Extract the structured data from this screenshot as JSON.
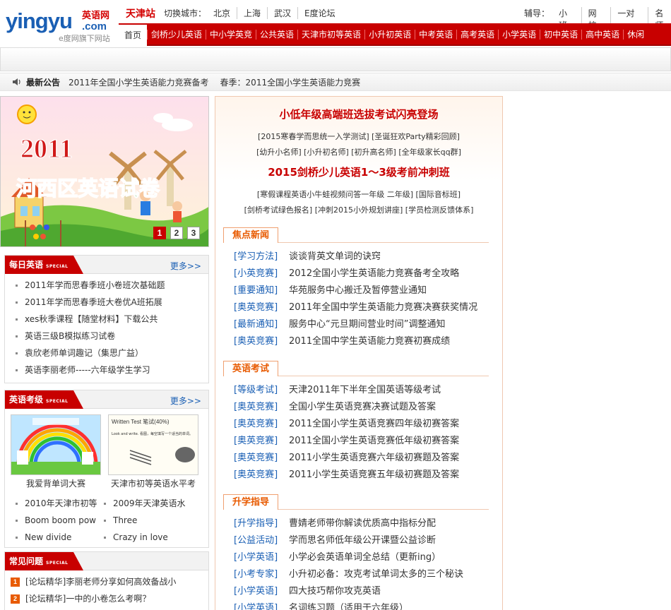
{
  "header": {
    "logo_main": "yingyu",
    "logo_com": ".com",
    "logo_cn": "英语网",
    "logo_sub": "e度网旗下网站",
    "station": "天津站",
    "switch_label": "切换城市：",
    "cities": [
      "北京",
      "上海",
      "武汉",
      "E度论坛"
    ],
    "aux_label": "辅导：",
    "aux_links": [
      "小班",
      "网校",
      "一对一",
      "名师"
    ]
  },
  "nav": {
    "home": "首页",
    "items": [
      "剑桥少儿英语",
      "中小学英竞",
      "公共英语",
      "天津市初等英语",
      "小升初英语",
      "中考英语",
      "高考英语",
      "小学英语",
      "初中英语",
      "高中英语",
      "休闲"
    ]
  },
  "announcement": {
    "label": "最新公告",
    "items": [
      "2011年全国小学生英语能力竞赛备考",
      "春季：2011全国小学生英语能力竞赛"
    ]
  },
  "banner": {
    "year": "2011",
    "title": "河西区英语试卷",
    "pages": [
      "1",
      "2",
      "3"
    ]
  },
  "daily": {
    "title": "每日英语",
    "tag": "SPECIAL",
    "more": "更多>>",
    "items": [
      "2011年学而思春季班小卷班次基础题",
      "2011年学而思春季班大卷优A班拓展",
      "xes秋季课程【随堂材料】下载公共",
      "英语三级B模拟练习试卷",
      "袁欣老师单词趣记（集思广益）",
      "英语李丽老师-----六年级学生学习"
    ]
  },
  "exam": {
    "title": "英语考级",
    "tag": "SPECIAL",
    "more": "更多>>",
    "thumbs": [
      {
        "caption": "我爱背单词大赛"
      },
      {
        "caption": "天津市初等英语水平考",
        "img_title": "Written Test 笔试(40%)",
        "img_text": "Look and write. 看图，每空填写一个适当的单词。"
      }
    ],
    "items": [
      "2010年天津市初等",
      "2009年天津英语水",
      "Boom boom pow",
      "Three",
      "New divide",
      "Crazy in love"
    ]
  },
  "faq": {
    "title": "常见问题",
    "tag": "SPECIAL",
    "items": [
      {
        "num": "1",
        "text": "[论坛精华]李丽老师分享如何高效备战小"
      },
      {
        "num": "2",
        "text": "[论坛精华]一中的小卷怎么考啊？"
      }
    ]
  },
  "feature": {
    "headline1": "小低年级高端班选拔考试闪亮登场",
    "links1a": "[2015寒春学而思统一入学测试] [圣诞狂欢Party精彩回顾]",
    "links1b": "[幼升小名师] [小升初名师] [初升高名师] [全年级家长qq群]",
    "headline2": "2015剑桥少儿英语1～3级考前冲刺班",
    "links2a": "[寒假课程英语小牛蛙视频问答一年级 二年级] [国际音标班]",
    "links2b": "[剑桥考试绿色报名] [冲刺2015小外规划讲座] [学员检测反馈体系]"
  },
  "sections": [
    {
      "title": "焦点新闻",
      "items": [
        {
          "cat": "[学习方法]",
          "text": "谈谈背英文单词的诀窍"
        },
        {
          "cat": "[小英竞赛]",
          "text": "2012全国小学生英语能力竞赛备考全攻略"
        },
        {
          "cat": "[重要通知]",
          "text": "华苑服务中心搬迁及暂停营业通知"
        },
        {
          "cat": "[奥英竞赛]",
          "text": "2011年全国中学生英语能力竞赛决赛获奖情况"
        },
        {
          "cat": "[最新通知]",
          "text": "服务中心“元旦期间营业时间”调整通知"
        },
        {
          "cat": "[奥英竞赛]",
          "text": "2011全国中学生英语能力竞赛初赛成绩"
        }
      ]
    },
    {
      "title": "英语考试",
      "items": [
        {
          "cat": "[等级考试]",
          "text": "天津2011年下半年全国英语等级考试"
        },
        {
          "cat": "[奥英竞赛]",
          "text": "全国小学生英语竞赛决赛试题及答案"
        },
        {
          "cat": "[奥英竞赛]",
          "text": "2011全国小学生英语竞赛四年级初赛答案"
        },
        {
          "cat": "[奥英竞赛]",
          "text": "2011全国小学生英语竞赛低年级初赛答案"
        },
        {
          "cat": "[奥英竞赛]",
          "text": "2011小学生英语竞赛六年级初赛题及答案"
        },
        {
          "cat": "[奥英竞赛]",
          "text": "2011小学生英语竞赛五年级初赛题及答案"
        }
      ]
    },
    {
      "title": "升学指导",
      "items": [
        {
          "cat": "[升学指导]",
          "text": "曹婧老师带你解读优质高中指标分配"
        },
        {
          "cat": "[公益活动]",
          "text": "学而思名师低年级公开课暨公益诊断"
        },
        {
          "cat": "[小学英语]",
          "text": "小学必会英语单词全总结（更新ing）"
        },
        {
          "cat": "[小考专家]",
          "text": "小升初必备：攻克考试单词太多的三个秘诀"
        },
        {
          "cat": "[小学英语]",
          "text": "四大技巧帮你攻克英语"
        },
        {
          "cat": "[小学英语]",
          "text": "名词练习题（适用于六年级）"
        }
      ]
    }
  ]
}
